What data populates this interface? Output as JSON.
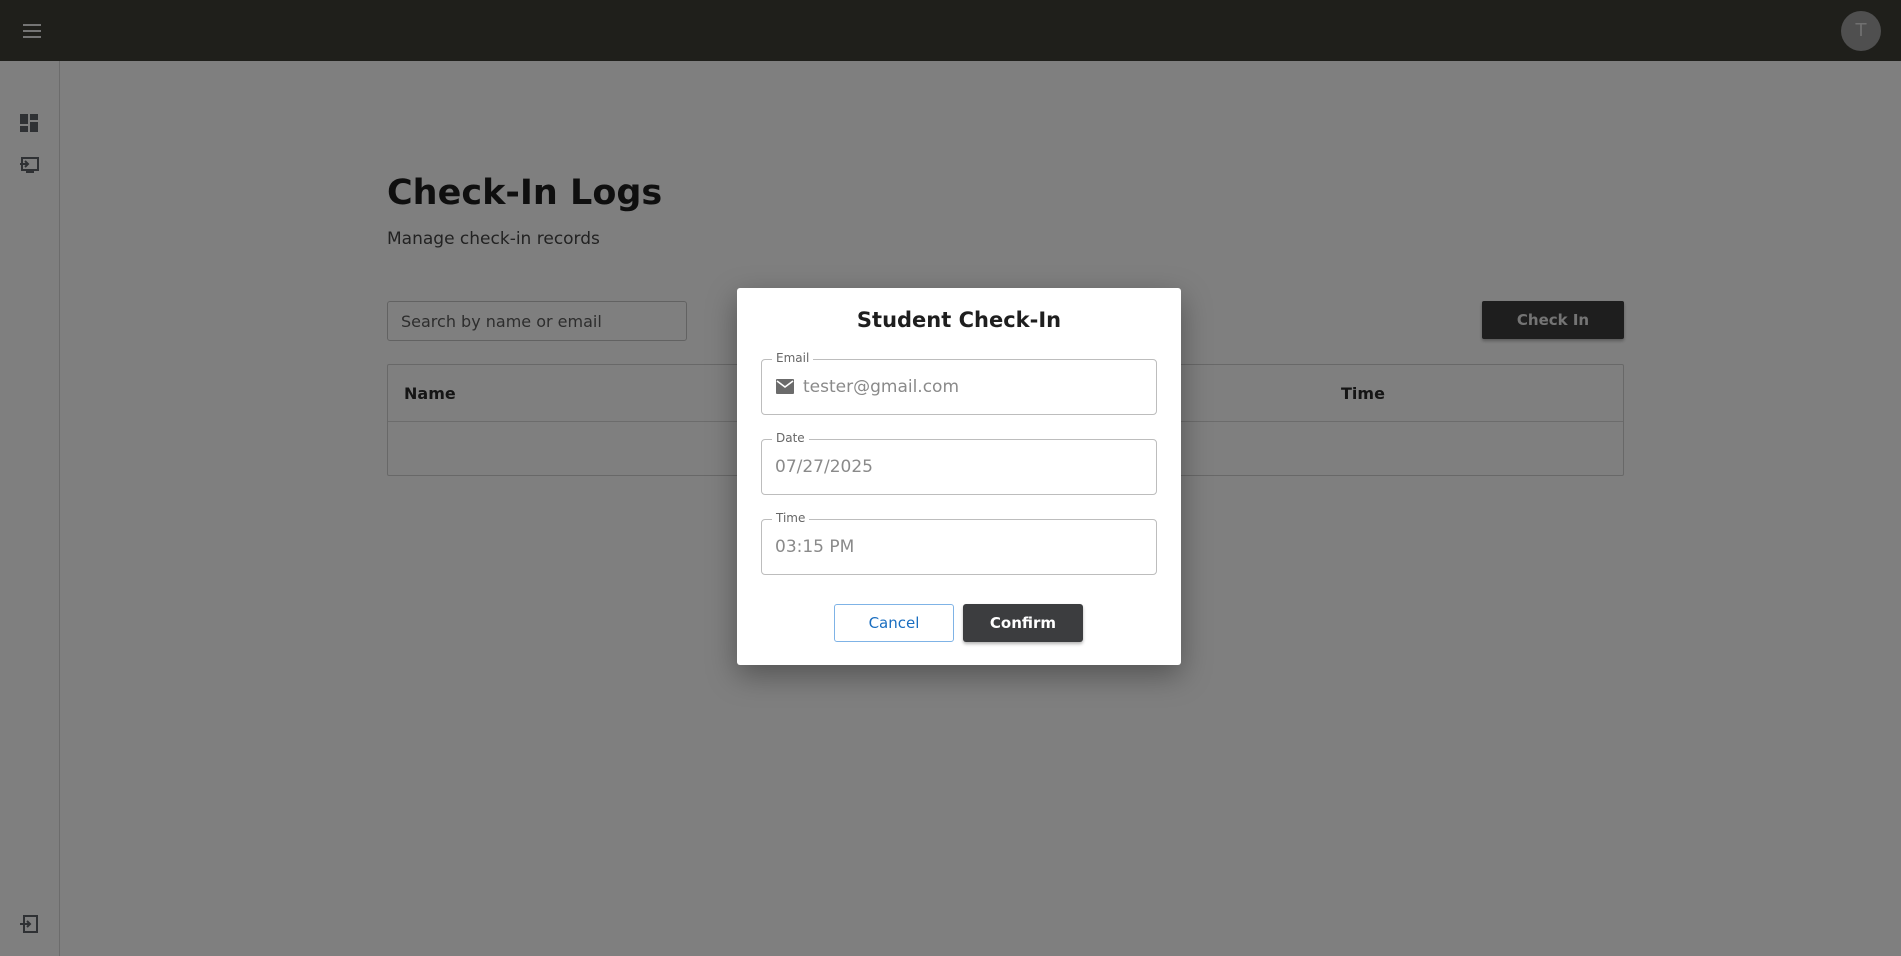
{
  "topbar": {
    "avatar_initial": "T"
  },
  "sidebar": {
    "items": [
      {
        "icon": "dashboard-icon"
      },
      {
        "icon": "checkin-log-icon"
      }
    ],
    "logout_icon": "logout-icon"
  },
  "page": {
    "title": "Check-In Logs",
    "subtitle": "Manage check-in records",
    "search_placeholder": "Search by name or email",
    "checkin_button": "Check In",
    "table": {
      "columns": [
        "Name",
        "Time"
      ]
    }
  },
  "dialog": {
    "title": "Student Check-In",
    "email": {
      "label": "Email",
      "value": "tester@gmail.com"
    },
    "date": {
      "label": "Date",
      "value": "07/27/2025"
    },
    "time": {
      "label": "Time",
      "value": "03:15 PM"
    },
    "cancel_label": "Cancel",
    "confirm_label": "Confirm"
  },
  "colors": {
    "topbar": "#3e3e36",
    "primary_dark": "#3c3d3f",
    "link_blue": "#1a6ec0"
  }
}
